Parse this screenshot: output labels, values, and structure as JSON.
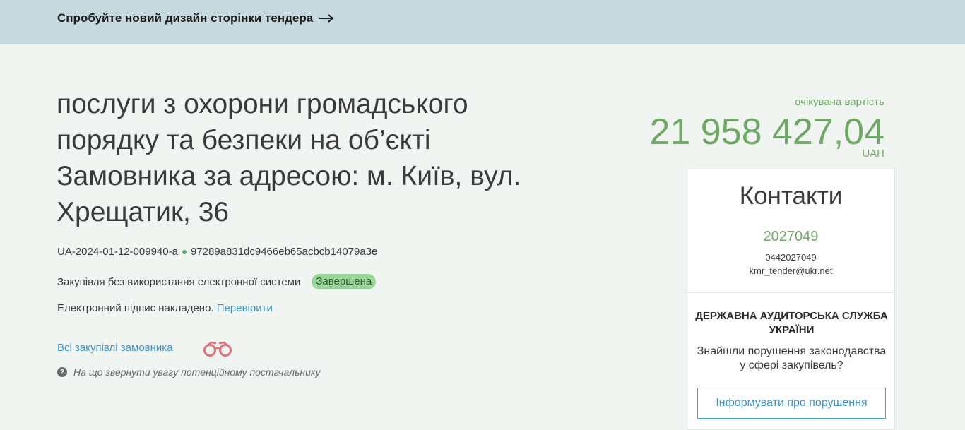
{
  "banner": {
    "text": "Спробуйте новий дизайн сторінки тендера",
    "icon": "arrow-right-icon"
  },
  "tender": {
    "title": "послуги з охорони громадського порядку та безпеки на об’єкті Замовника за адресою: м. Київ, вул. Хрещатик, 36",
    "id": "UA-2024-01-12-009940-a",
    "hash": "97289a831dc9466eb65acbcb14079a3e",
    "procurement_method": "Закупівля без використання електронної системи",
    "status": "Завершена",
    "signature_text": "Електронний підпис накладено.",
    "signature_check": "Перевірити",
    "all_purchases": "Всі закупівлі замовника",
    "hint": "На що звернути увагу потенційному постачальнику"
  },
  "expected_value": {
    "label": "очікувана вартість",
    "amount": "21 958 427,04",
    "currency": "UAH"
  },
  "contacts": {
    "title": "Контакти",
    "name": "2027049",
    "phone": "0442027049",
    "email": "kmr_tender@ukr.net"
  },
  "audit": {
    "title": "ДЕРЖАВНА АУДИТОРСЬКА СЛУЖБА УКРАЇНИ",
    "text": "Знайшли порушення законодавства у сфері закупівель?",
    "button": "Інформувати про порушення"
  },
  "colors": {
    "banner_bg": "#c5d9df",
    "page_bg": "#f0f5f2",
    "accent_green": "#6fa865",
    "link_blue": "#3b93c9",
    "badge_green": "#9bd59a"
  }
}
